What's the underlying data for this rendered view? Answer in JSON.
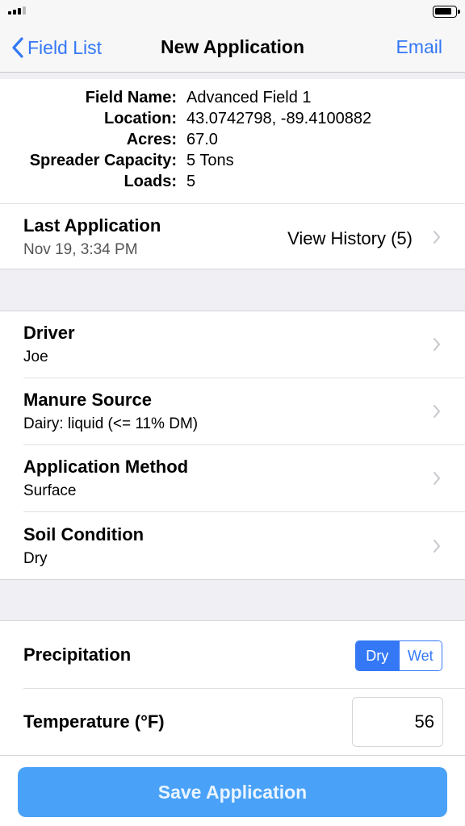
{
  "nav": {
    "back_label": "Field List",
    "title": "New Application",
    "action_label": "Email"
  },
  "field_info": [
    {
      "label": "Field Name:",
      "value": "Advanced Field 1"
    },
    {
      "label": "Location:",
      "value": "43.0742798, -89.4100882"
    },
    {
      "label": "Acres:",
      "value": "67.0"
    },
    {
      "label": "Spreader Capacity:",
      "value": "5 Tons"
    },
    {
      "label": "Loads:",
      "value": "5"
    }
  ],
  "last_application": {
    "title": "Last Application",
    "date": "Nov 19, 3:34 PM",
    "history_label": "View History (5)"
  },
  "details": [
    {
      "title": "Driver",
      "value": "Joe"
    },
    {
      "title": "Manure Source",
      "value": "Dairy: liquid (<= 11% DM)"
    },
    {
      "title": "Application Method",
      "value": "Surface"
    },
    {
      "title": "Soil Condition",
      "value": "Dry"
    }
  ],
  "weather": {
    "precipitation_label": "Precipitation",
    "precipitation_options": [
      "Dry",
      "Wet"
    ],
    "precipitation_selected": "Dry",
    "temperature_label": "Temperature (°F)",
    "temperature_value": "56"
  },
  "save_label": "Save Application",
  "colors": {
    "accent": "#3478f6",
    "save_button": "#4aa2f8",
    "group_background": "#efeff4"
  }
}
